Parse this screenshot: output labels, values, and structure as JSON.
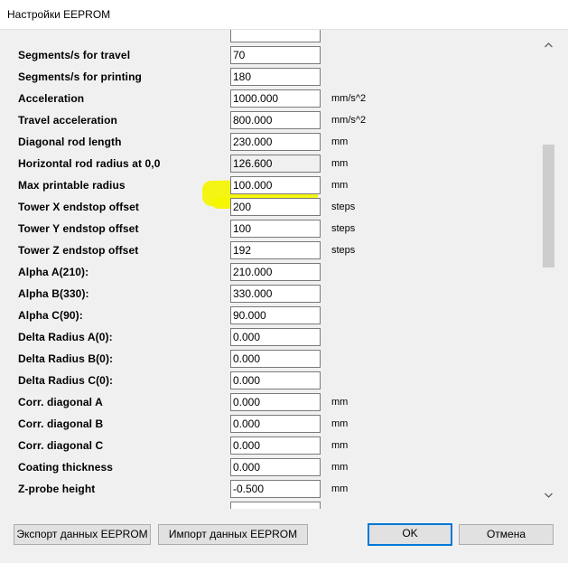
{
  "window": {
    "title": "Настройки EEPROM"
  },
  "rows": [
    {
      "label": "Segments/s for travel",
      "value": "70",
      "unit": ""
    },
    {
      "label": "Segments/s for printing",
      "value": "180",
      "unit": ""
    },
    {
      "label": "Acceleration",
      "value": "1000.000",
      "unit": "mm/s^2"
    },
    {
      "label": "Travel acceleration",
      "value": "800.000",
      "unit": "mm/s^2"
    },
    {
      "label": "Diagonal rod length",
      "value": "230.000",
      "unit": "mm"
    },
    {
      "label": "Horizontal rod radius at 0,0",
      "value": "126.600",
      "unit": "mm"
    },
    {
      "label": "Max printable radius",
      "value": "100.000",
      "unit": "mm"
    },
    {
      "label": "Tower X endstop offset",
      "value": "200",
      "unit": "steps"
    },
    {
      "label": "Tower Y endstop offset",
      "value": "100",
      "unit": "steps"
    },
    {
      "label": "Tower Z endstop offset",
      "value": "192",
      "unit": "steps"
    },
    {
      "label": "Alpha A(210):",
      "value": "210.000",
      "unit": ""
    },
    {
      "label": "Alpha B(330):",
      "value": "330.000",
      "unit": ""
    },
    {
      "label": "Alpha C(90):",
      "value": "90.000",
      "unit": ""
    },
    {
      "label": "Delta Radius A(0):",
      "value": "0.000",
      "unit": ""
    },
    {
      "label": "Delta Radius B(0):",
      "value": "0.000",
      "unit": ""
    },
    {
      "label": "Delta Radius C(0):",
      "value": "0.000",
      "unit": ""
    },
    {
      "label": "Corr. diagonal A",
      "value": "0.000",
      "unit": "mm"
    },
    {
      "label": "Corr. diagonal B",
      "value": "0.000",
      "unit": "mm"
    },
    {
      "label": "Corr. diagonal C",
      "value": "0.000",
      "unit": "mm"
    },
    {
      "label": "Coating thickness",
      "value": "0.000",
      "unit": "mm"
    },
    {
      "label": "Z-probe height",
      "value": "-0.500",
      "unit": "mm"
    }
  ],
  "buttons": {
    "export": "Экспорт данных EEPROM",
    "import": "Импорт данных EEPROM",
    "ok": "OK",
    "cancel": "Отмена"
  },
  "icons": {
    "scroll_up": "chevron-up-icon",
    "scroll_down": "chevron-down-icon"
  }
}
